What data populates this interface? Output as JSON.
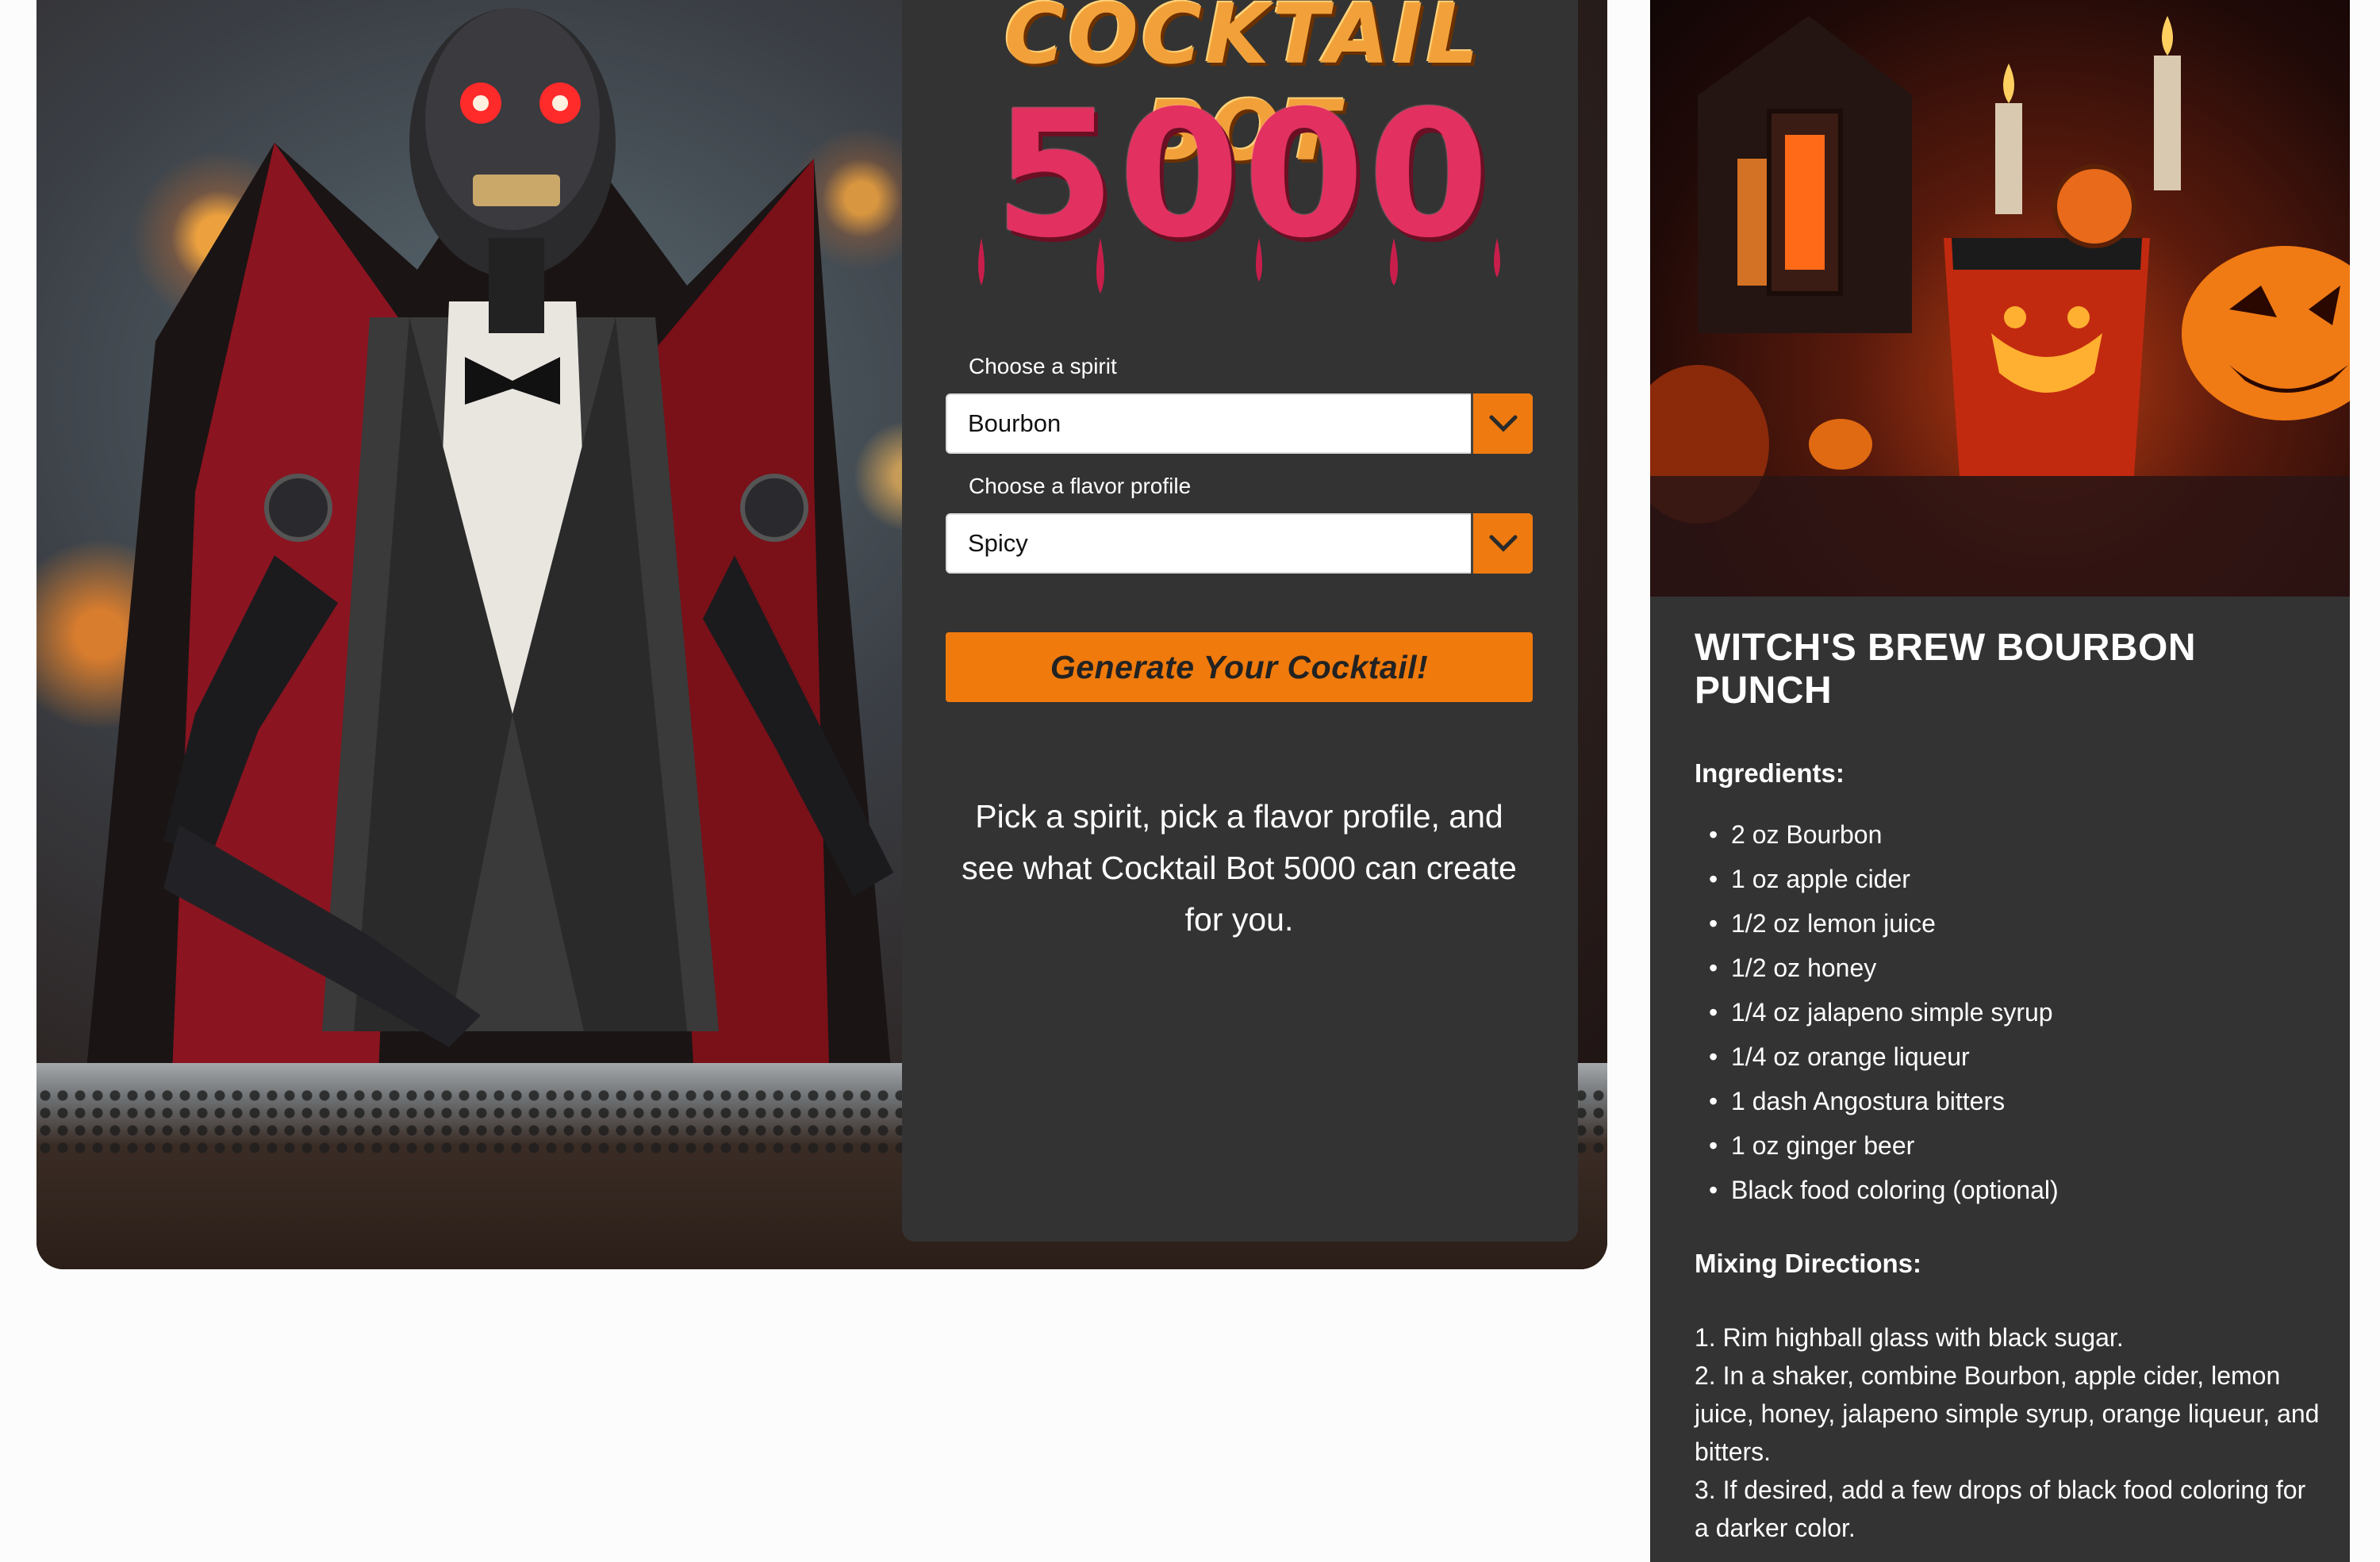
{
  "logo": {
    "line1": "COCKTAIL BOT",
    "line2": "5000"
  },
  "form": {
    "spirit_label": "Choose a spirit",
    "spirit_value": "Bourbon",
    "flavor_label": "Choose a flavor profile",
    "flavor_value": "Spicy",
    "generate_label": "Generate Your Cocktail!",
    "blurb": "Pick a spirit, pick a flavor profile, and see what Cocktail Bot 5000 can create for you."
  },
  "recipe": {
    "title": "WITCH'S BREW BOURBON PUNCH",
    "ingredients_heading": "Ingredients:",
    "ingredients": [
      "2 oz Bourbon",
      "1 oz apple cider",
      "1/2 oz lemon juice",
      "1/2 oz honey",
      "1/4 oz jalapeno simple syrup",
      "1/4 oz orange liqueur",
      "1 dash Angostura bitters",
      "1 oz ginger beer",
      "Black food coloring (optional)"
    ],
    "directions_heading": "Mixing Directions:",
    "directions": [
      "1. Rim highball glass with black sugar.",
      "2. In a shaker, combine Bourbon, apple cider, lemon juice, honey, jalapeno simple syrup, orange liqueur, and bitters.",
      "3. If desired, add a few drops of black food coloring for a darker color."
    ]
  },
  "colors": {
    "accent": "#f07a0c",
    "panel": "#333333",
    "logo_red": "#e23060",
    "logo_orange": "#f2a13a"
  },
  "icons": {
    "dropdown": "chevron-down-icon"
  }
}
